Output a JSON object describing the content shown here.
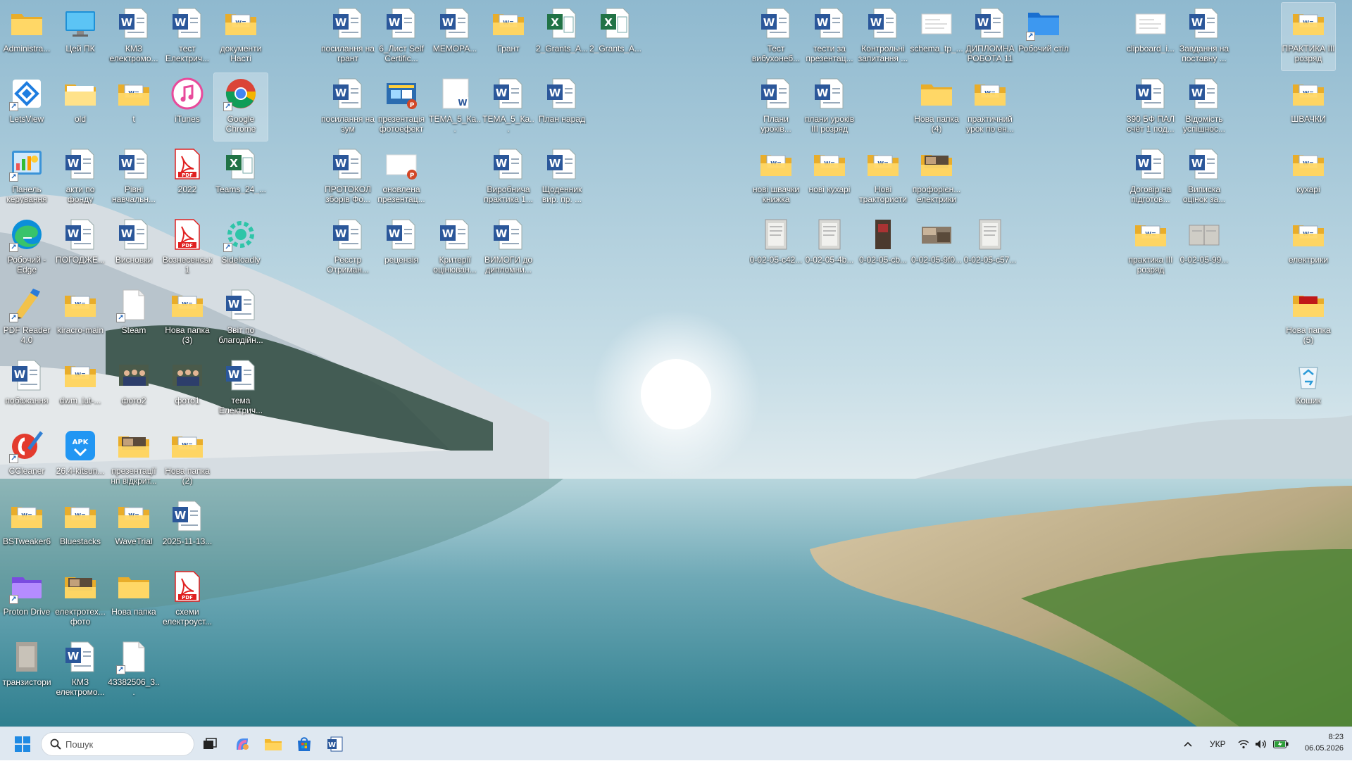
{
  "desktop_icons": [
    {
      "name": "Administra...",
      "type": "folder-yellow"
    },
    {
      "name": "Цей ПК",
      "type": "pc"
    },
    {
      "name": "КМЗ електромо...",
      "type": "word"
    },
    {
      "name": "тест Електрич...",
      "type": "word"
    },
    {
      "name": "документи Насті",
      "type": "folder-doc"
    },
    {
      "name": "посилання на грант",
      "type": "word"
    },
    {
      "name": "6_Лист Self Certific...",
      "type": "word"
    },
    {
      "name": "МЕМОРА...",
      "type": "word"
    },
    {
      "name": "Грант",
      "type": "folder-doc"
    },
    {
      "name": "2_Grants_A...",
      "type": "excel"
    },
    {
      "name": "2_Grants_A...",
      "type": "excel"
    },
    {
      "name": "Тест вибухонеб...",
      "type": "word"
    },
    {
      "name": "тести за презентац...",
      "type": "word"
    },
    {
      "name": "Контрольні запитання ...",
      "type": "word"
    },
    {
      "name": "schema_tp_...",
      "type": "image-white"
    },
    {
      "name": "ДИПЛОМНА РОБОТА 11",
      "type": "word"
    },
    {
      "name": "Робочий стіл",
      "type": "desktop-folder"
    },
    {
      "name": "clipboard_i...",
      "type": "image-white"
    },
    {
      "name": "Завдання на поставну ...",
      "type": "word"
    },
    {
      "name": "ПРАКТИКА ІІІ розряд",
      "type": "folder-doc"
    },
    {
      "name": "LetsView",
      "type": "letsview"
    },
    {
      "name": "old",
      "type": "folder-white"
    },
    {
      "name": "t",
      "type": "folder-doc"
    },
    {
      "name": "iTunes",
      "type": "itunes"
    },
    {
      "name": "Google Chrome",
      "type": "chrome"
    },
    {
      "name": "посилання на зум",
      "type": "word"
    },
    {
      "name": "презентація фотоефект",
      "type": "ppt"
    },
    {
      "name": "ТЕМА_5_Ка...",
      "type": "word-blank"
    },
    {
      "name": "ТЕМА_5_Ка...",
      "type": "word"
    },
    {
      "name": "План нарад",
      "type": "word"
    },
    {
      "name": "Плани уроків...",
      "type": "word"
    },
    {
      "name": "плани уроків ІІІ розряд",
      "type": "word"
    },
    {
      "name": "Нова папка (4)",
      "type": "folder-yellow"
    },
    {
      "name": "практичний урок по ен...",
      "type": "folder-doc"
    },
    {
      "name": "390 БФ ПАЛ счёт 1 под...",
      "type": "word"
    },
    {
      "name": "Відомість успішнос...",
      "type": "word"
    },
    {
      "name": "ШВАЧКИ",
      "type": "folder-doc"
    },
    {
      "name": "Панель керування",
      "type": "control-panel"
    },
    {
      "name": "акти по фонду",
      "type": "word"
    },
    {
      "name": "Рівні навчальн...",
      "type": "word"
    },
    {
      "name": "2022",
      "type": "pdf"
    },
    {
      "name": "Teams_24_...",
      "type": "excel"
    },
    {
      "name": "ПРОТОКОЛ зборів Фо...",
      "type": "word"
    },
    {
      "name": "оновлена презентац...",
      "type": "ppt-white"
    },
    {
      "name": "Виробнича практика 1...",
      "type": "word"
    },
    {
      "name": "Щоденник вир. пр. ...",
      "type": "word"
    },
    {
      "name": "нові швачки книжка",
      "type": "folder-doc"
    },
    {
      "name": "нові кухарі",
      "type": "folder-doc"
    },
    {
      "name": "Нові трактористи",
      "type": "folder-doc"
    },
    {
      "name": "профорієн... електрики",
      "type": "folder-photo"
    },
    {
      "name": "Договір на підготов...",
      "type": "word"
    },
    {
      "name": "Виписка оцінок за...",
      "type": "word"
    },
    {
      "name": "кухарі",
      "type": "folder-doc"
    },
    {
      "name": "Робочий - Edge",
      "type": "edge"
    },
    {
      "name": "ПОГОДЖЕ...",
      "type": "word"
    },
    {
      "name": "Висновки",
      "type": "word"
    },
    {
      "name": "Вознесенськ 1",
      "type": "pdf"
    },
    {
      "name": "Sideloadly",
      "type": "sideloadly"
    },
    {
      "name": "Реєстр Отриман...",
      "type": "word"
    },
    {
      "name": "рецензія",
      "type": "word"
    },
    {
      "name": "Критерії оцінюван...",
      "type": "word"
    },
    {
      "name": "ВИМОГИ до дипломни...",
      "type": "word"
    },
    {
      "name": "0-02-05-c42...",
      "type": "photo-doc"
    },
    {
      "name": "0-02-05-4b...",
      "type": "photo-doc"
    },
    {
      "name": "0-02-05-cb...",
      "type": "photo-dark"
    },
    {
      "name": "0-02-05-9f0...",
      "type": "photo-wide"
    },
    {
      "name": "0-02-05-c57...",
      "type": "photo-doc"
    },
    {
      "name": "практика ІІІ розряд",
      "type": "folder-doc"
    },
    {
      "name": "0-02-05-99...",
      "type": "photo-book"
    },
    {
      "name": "електрики",
      "type": "folder-doc"
    },
    {
      "name": "PDF Reader 4.0",
      "type": "pdfreader"
    },
    {
      "name": "kiracro-main",
      "type": "folder-doc"
    },
    {
      "name": "Steam",
      "type": "blank-file"
    },
    {
      "name": "Нова папка (3)",
      "type": "folder-doc"
    },
    {
      "name": "Звіт по благодійн...",
      "type": "word"
    },
    {
      "name": "Нова папка (5)",
      "type": "folder-red"
    },
    {
      "name": "побажання",
      "type": "word"
    },
    {
      "name": "dwm_lut-...",
      "type": "folder-doc"
    },
    {
      "name": "фото2",
      "type": "photo-people"
    },
    {
      "name": "фото1",
      "type": "photo-people"
    },
    {
      "name": "тема Електрич...",
      "type": "word"
    },
    {
      "name": "Кошик",
      "type": "recycle"
    },
    {
      "name": "CCleaner",
      "type": "ccleaner"
    },
    {
      "name": "26.4-kitsun...",
      "type": "apk"
    },
    {
      "name": "презентації нп відкрит...",
      "type": "folder-photo"
    },
    {
      "name": "Нова папка (2)",
      "type": "folder-doc"
    },
    {
      "name": "BSTweaker6",
      "type": "folder-doc"
    },
    {
      "name": "Bluestacks",
      "type": "folder-doc"
    },
    {
      "name": "WaveTrial",
      "type": "folder-doc"
    },
    {
      "name": "2025-11-13...",
      "type": "word"
    },
    {
      "name": "Proton Drive",
      "type": "proton"
    },
    {
      "name": "електротех... фото",
      "type": "folder-photo"
    },
    {
      "name": "Нова папка",
      "type": "folder-yellow"
    },
    {
      "name": "схеми електроуст...",
      "type": "pdf"
    },
    {
      "name": "транзистори",
      "type": "photo-gray"
    },
    {
      "name": "КМЗ електромо...",
      "type": "word"
    },
    {
      "name": "43382506_3...",
      "type": "blank-file"
    }
  ],
  "taskbar": {
    "search_placeholder": "Пошук",
    "apps": [
      "start-icon",
      "task-view-icon",
      "copilot-icon",
      "file-explorer-icon",
      "microsoft-store-icon",
      "word-icon"
    ],
    "language": "УКР",
    "time": "8:23",
    "date": "06.05.2026"
  },
  "colors": {
    "word_blue": "#2b579a",
    "excel_green": "#217346",
    "pdf_red": "#e02020",
    "folder_yellow": "#f7c948",
    "taskbar_bg": "#dfe8f1"
  }
}
